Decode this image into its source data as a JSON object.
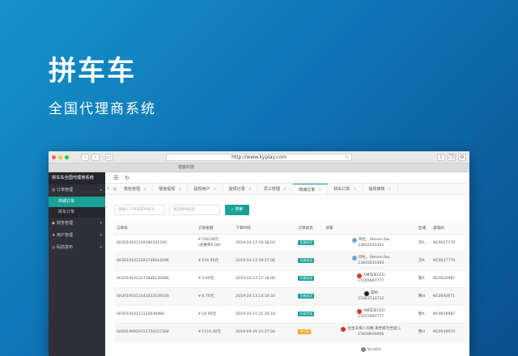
{
  "hero": {
    "title": "拼车车",
    "subtitle": "全国代理商系统"
  },
  "browser": {
    "url": "http://www.kyplay.com",
    "tab_label": "谱客科技",
    "accent": "#1aa094"
  },
  "sidebar": {
    "brand": "拼车车全国代理商系统",
    "groups": [
      {
        "label": "订单管理",
        "icon": "cart-icon",
        "expanded": true,
        "items": [
          {
            "label": "商城订单",
            "active": true
          },
          {
            "label": "拼车订单",
            "active": false
          }
        ]
      },
      {
        "label": "财务管理",
        "icon": "money-icon",
        "expanded": false,
        "items": []
      },
      {
        "label": "用户管理",
        "icon": "user-icon",
        "expanded": false,
        "items": []
      },
      {
        "label": "码前发布",
        "icon": "gear-icon",
        "expanded": false,
        "items": []
      }
    ]
  },
  "tabs": [
    "角色管理",
    "额度提现",
    "提现用户",
    "提现记录",
    "员工管理",
    "商城订单",
    "拼车订单",
    "提现审核"
  ],
  "active_tab": "商城订单",
  "filters": {
    "order_placeholder": "请输入订单号或手机号",
    "date_placeholder": "请选择时间段",
    "search_label": "搜索"
  },
  "table": {
    "columns": [
      "订单号",
      "订单金额",
      "下单时间",
      "订单状态",
      "买家",
      "区域",
      "提车码"
    ],
    "rows": [
      {
        "order": "SH201910131938034121​6",
        "amount": "¥ 106.00元",
        "amount2": "(优惠券6.00)",
        "time": "2019-10-13 19:38:03",
        "status": "交易成功",
        "status_color": "#1aa094",
        "buyer": "阿杜、Steven.foo",
        "phone": "13810031393",
        "avatar_color": "#6aa7d8",
        "region": "济A",
        "code": "NC0017779"
      },
      {
        "order": "SH201910131937066142​96",
        "amount": "¥ 216.90元",
        "amount2": "",
        "time": "2019-10-13 19:37:06",
        "status": "交易成功",
        "status_color": "#1aa094",
        "buyer": "阿杜、Steven.foo",
        "phone": "13810031393",
        "avatar_color": "#6aa7d8",
        "region": "济A",
        "code": "NC0017779"
      },
      {
        "order": "SH201910131718461264​66",
        "amount": "¥ 4.60元",
        "amount2": "",
        "time": "2019-10-13 17:18:46",
        "status": "交易成功",
        "status_color": "#1aa094",
        "buyer": "A拼车车CEO",
        "phone": "15555697777",
        "avatar_color": "#d9342b",
        "region": "鲁A",
        "code": "NC0010987"
      },
      {
        "order": "SH201910131410331091​00",
        "amount": "¥ 0.70元",
        "amount2": "",
        "time": "2019-10-13 14:10:33",
        "status": "交易成功",
        "status_color": "#1aa094",
        "buyer": "常熙",
        "phone": "15303733722",
        "avatar_color": "#222222",
        "region": "豫H",
        "code": "NC0042971"
      },
      {
        "order": "SH201910111120649484",
        "amount": "¥ 24.90元",
        "amount2": "",
        "time": "2019-10-11 11:20:18",
        "status": "交易完成",
        "status_color": "#1aa094",
        "buyer": "A拼车车CEO",
        "phone": "15555697777",
        "avatar_color": "#d9342b",
        "region": "鲁A",
        "code": "NC0010987"
      },
      {
        "order": "SH201909291527042273​04",
        "amount": "¥ 1110.00元",
        "amount2": "",
        "time": "2019-09-29 15:27:04",
        "status": "待付款",
        "status_color": "#f5a623",
        "buyer": "出生天梅人华圃 来世愿为世黑儿",
        "phone": "15838650006",
        "avatar_color": "#c0392b",
        "region": "豫H",
        "code": "NC0019974"
      },
      {
        "order": "",
        "amount": "",
        "amount2": "",
        "time": "",
        "status": "",
        "status_color": "#1aa094",
        "buyer": "Scratch",
        "phone": "",
        "avatar_color": "#888888",
        "region": "",
        "code": ""
      }
    ]
  }
}
